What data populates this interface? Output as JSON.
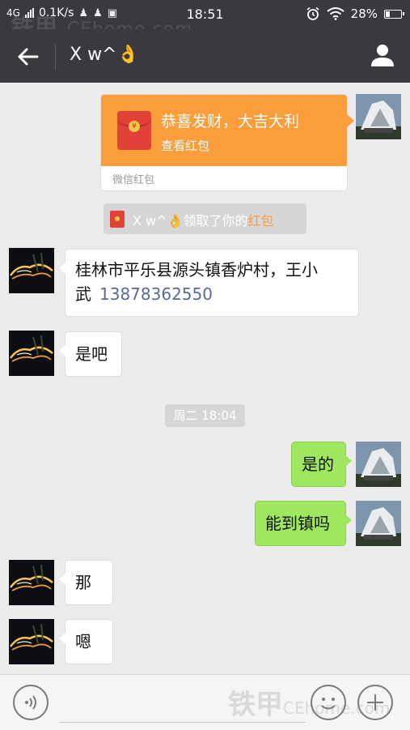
{
  "status_bar": {
    "network": "4G",
    "speed": "0.1K/s",
    "time": "18:51",
    "battery": "28%",
    "battery_level": 0.28,
    "icons": [
      "signal-icon",
      "qq-icon",
      "qq-icon",
      "sim-icon",
      "alarm-icon",
      "wifi-icon",
      "battery-icon"
    ]
  },
  "watermark": {
    "cn": "铁甲",
    "en": "CEhome.com"
  },
  "header": {
    "title": "X w^👌",
    "back_icon": "back-arrow-icon",
    "profile_icon": "user-profile-icon"
  },
  "messages": {
    "red_packet": {
      "title": "恭喜发财，大吉大利",
      "subtitle": "查看红包",
      "footer": "微信红包",
      "color": "#fa9d3b"
    },
    "claim_notice": {
      "prefix": "X w^👌领取了你的",
      "highlight": "红包"
    },
    "address_line1": "桂林市平乐县源头镇香炉村，王小",
    "address_line2": "武",
    "phone": "13878362550",
    "recv_1": "是吧",
    "time_notice": "周二 18:04",
    "sent_1": "是的",
    "sent_2": "能到镇吗",
    "recv_2": "那",
    "recv_3": "嗯"
  },
  "colors": {
    "sent_bubble": "#9fe75e",
    "bar_background": "#393a3f",
    "chat_background": "#ececec",
    "link": "#576b95"
  },
  "input_bar": {
    "placeholder": "",
    "voice_icon": "voice-icon",
    "emoji_icon": "emoji-icon",
    "plus_icon": "plus-icon"
  }
}
